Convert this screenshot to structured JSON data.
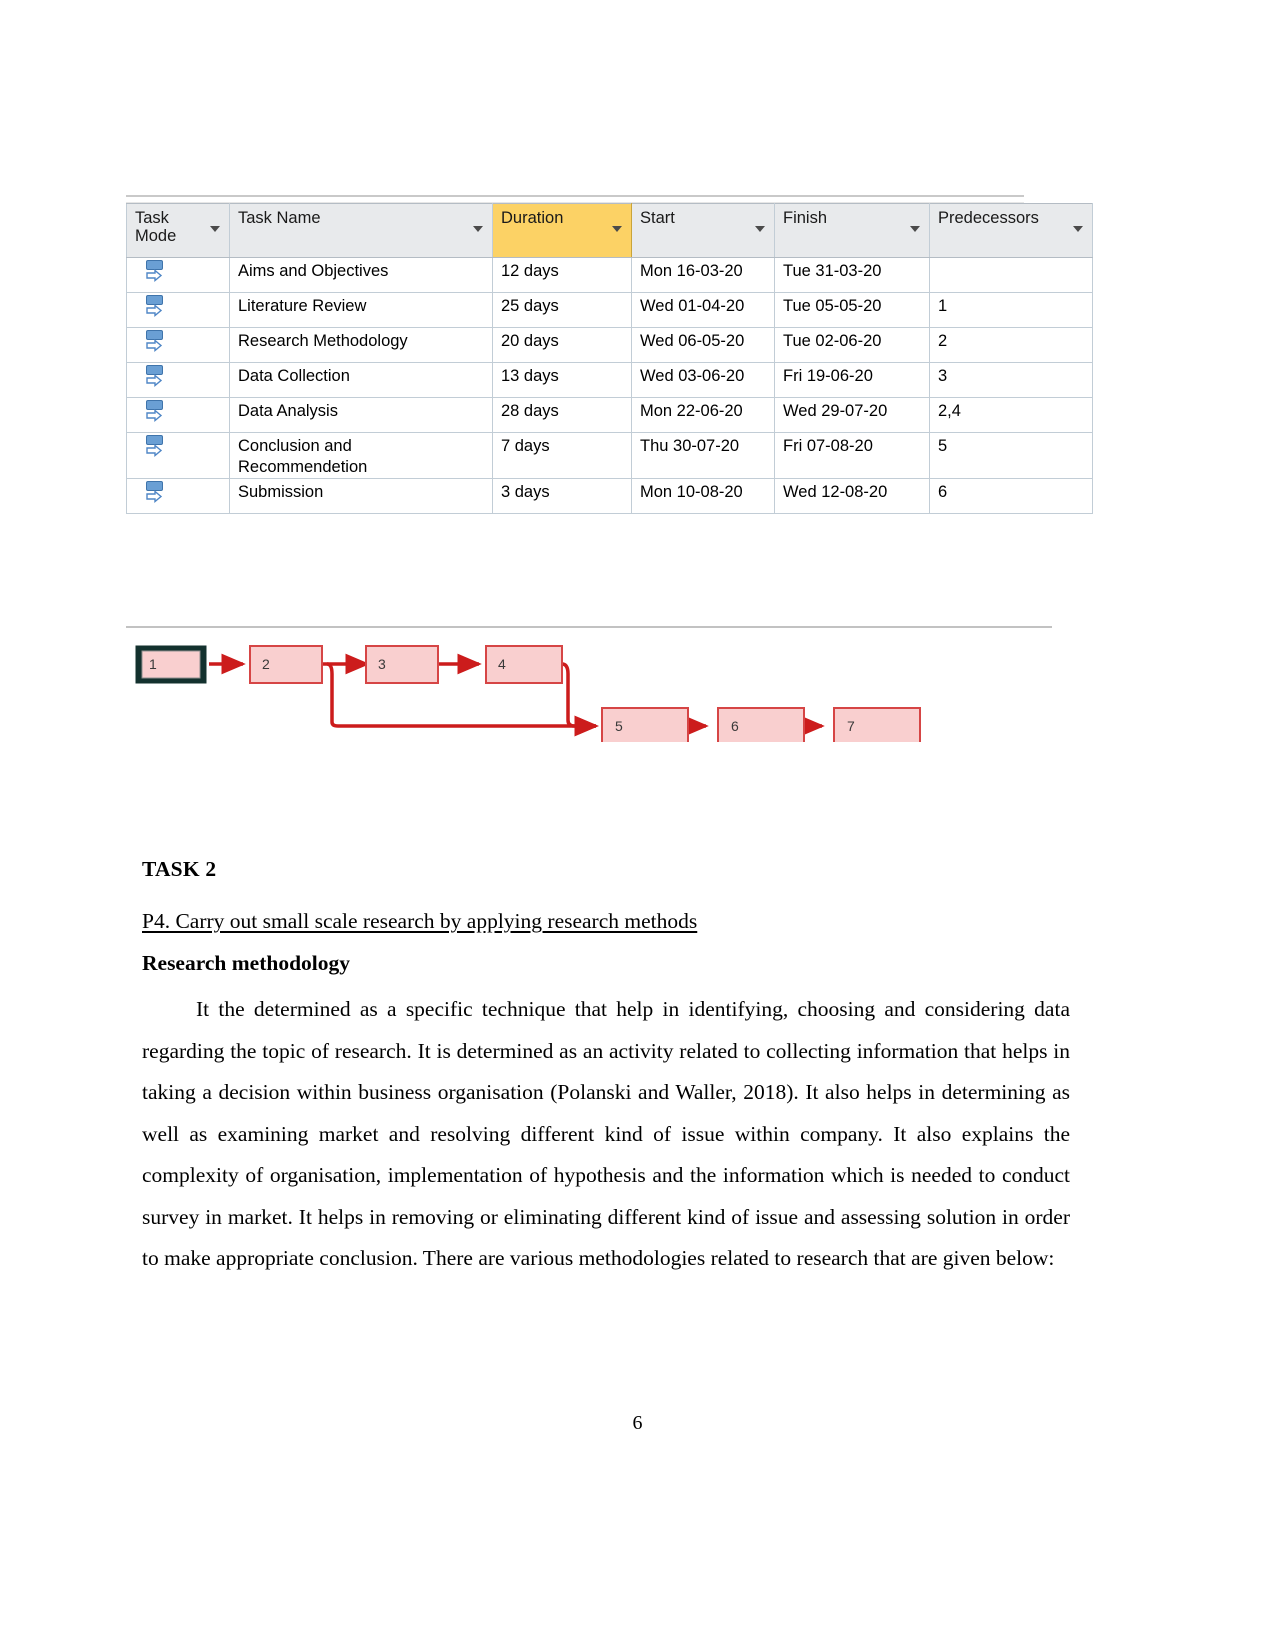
{
  "project_table": {
    "columns": [
      {
        "key": "mode",
        "label": "Task Mode",
        "highlight": false
      },
      {
        "key": "name",
        "label": "Task Name",
        "highlight": false
      },
      {
        "key": "dur",
        "label": "Duration",
        "highlight": true
      },
      {
        "key": "start",
        "label": "Start",
        "highlight": false
      },
      {
        "key": "fin",
        "label": "Finish",
        "highlight": false
      },
      {
        "key": "pred",
        "label": "Predecessors",
        "highlight": false
      }
    ],
    "header_labels": {
      "task_mode_line1": "Task",
      "task_mode_line2": "Mode",
      "task_name": "Task Name",
      "duration": "Duration",
      "start": "Start",
      "finish": "Finish",
      "predecessors": "Predecessors"
    },
    "rows": [
      {
        "name": "Aims and Objectives",
        "duration": "12 days",
        "start": "Mon 16-03-20",
        "finish": "Tue 31-03-20",
        "predecessors": "",
        "selected": false
      },
      {
        "name": "Literature Review",
        "duration": "25 days",
        "start": "Wed 01-04-20",
        "finish": "Tue 05-05-20",
        "predecessors": "1",
        "selected": false
      },
      {
        "name": "Research Methodology",
        "duration": "20 days",
        "start": "Wed 06-05-20",
        "finish": "Tue 02-06-20",
        "predecessors": "2",
        "selected": true
      },
      {
        "name": "Data Collection",
        "duration": "13 days",
        "start": "Wed 03-06-20",
        "finish": "Fri 19-06-20",
        "predecessors": "3",
        "selected": true
      },
      {
        "name": "Data Analysis",
        "duration": "28 days",
        "start": "Mon 22-06-20",
        "finish": "Wed 29-07-20",
        "predecessors": "2,4",
        "selected": true
      },
      {
        "name": "Conclusion and Recommendetion",
        "duration": "7 days",
        "start": "Thu 30-07-20",
        "finish": "Fri 07-08-20",
        "predecessors": "5",
        "selected": true
      },
      {
        "name": "Submission",
        "duration": "3 days",
        "start": "Mon 10-08-20",
        "finish": "Wed 12-08-20",
        "predecessors": "6",
        "selected": false
      }
    ],
    "colors": {
      "duration_header_fill": "#fcd265",
      "header_fill": "#e8eaec",
      "selection_fill": "#dce9f5",
      "grid_line": "#c2cdd6"
    }
  },
  "network_diagram": {
    "nodes": [
      {
        "id": "1",
        "label": "1",
        "selected": true
      },
      {
        "id": "2",
        "label": "2",
        "selected": false
      },
      {
        "id": "3",
        "label": "3",
        "selected": false
      },
      {
        "id": "4",
        "label": "4",
        "selected": false
      },
      {
        "id": "5",
        "label": "5",
        "selected": false
      },
      {
        "id": "6",
        "label": "6",
        "selected": false
      },
      {
        "id": "7",
        "label": "7",
        "selected": false
      }
    ],
    "links": [
      {
        "from": "1",
        "to": "2"
      },
      {
        "from": "2",
        "to": "3"
      },
      {
        "from": "3",
        "to": "4"
      },
      {
        "from": "4",
        "to": "5"
      },
      {
        "from": "2",
        "to": "5"
      },
      {
        "from": "5",
        "to": "6"
      },
      {
        "from": "6",
        "to": "7"
      }
    ],
    "colors": {
      "node_fill": "#f9cfcf",
      "node_border": "#d64545",
      "link": "#cc1c1c",
      "selected_border": "#13312e"
    }
  },
  "document": {
    "task_heading": "TASK 2",
    "p4_heading": "P4. Carry out small scale research by applying research methods",
    "methodology_heading": "Research methodology",
    "body_paragraph": "It the determined as a specific technique that help in identifying, choosing and considering data regarding the topic of research. It is determined as an activity related to collecting information that helps in taking a decision within business organisation (Polanski and Waller, 2018). It also helps in determining as well as examining market and resolving different kind of issue within company. It also explains the complexity of organisation, implementation of hypothesis and the information which is needed to conduct survey in market. It helps in removing or eliminating different kind of issue and assessing solution in order to make appropriate conclusion. There are various methodologies related to research that are given below:",
    "page_number": "6"
  }
}
